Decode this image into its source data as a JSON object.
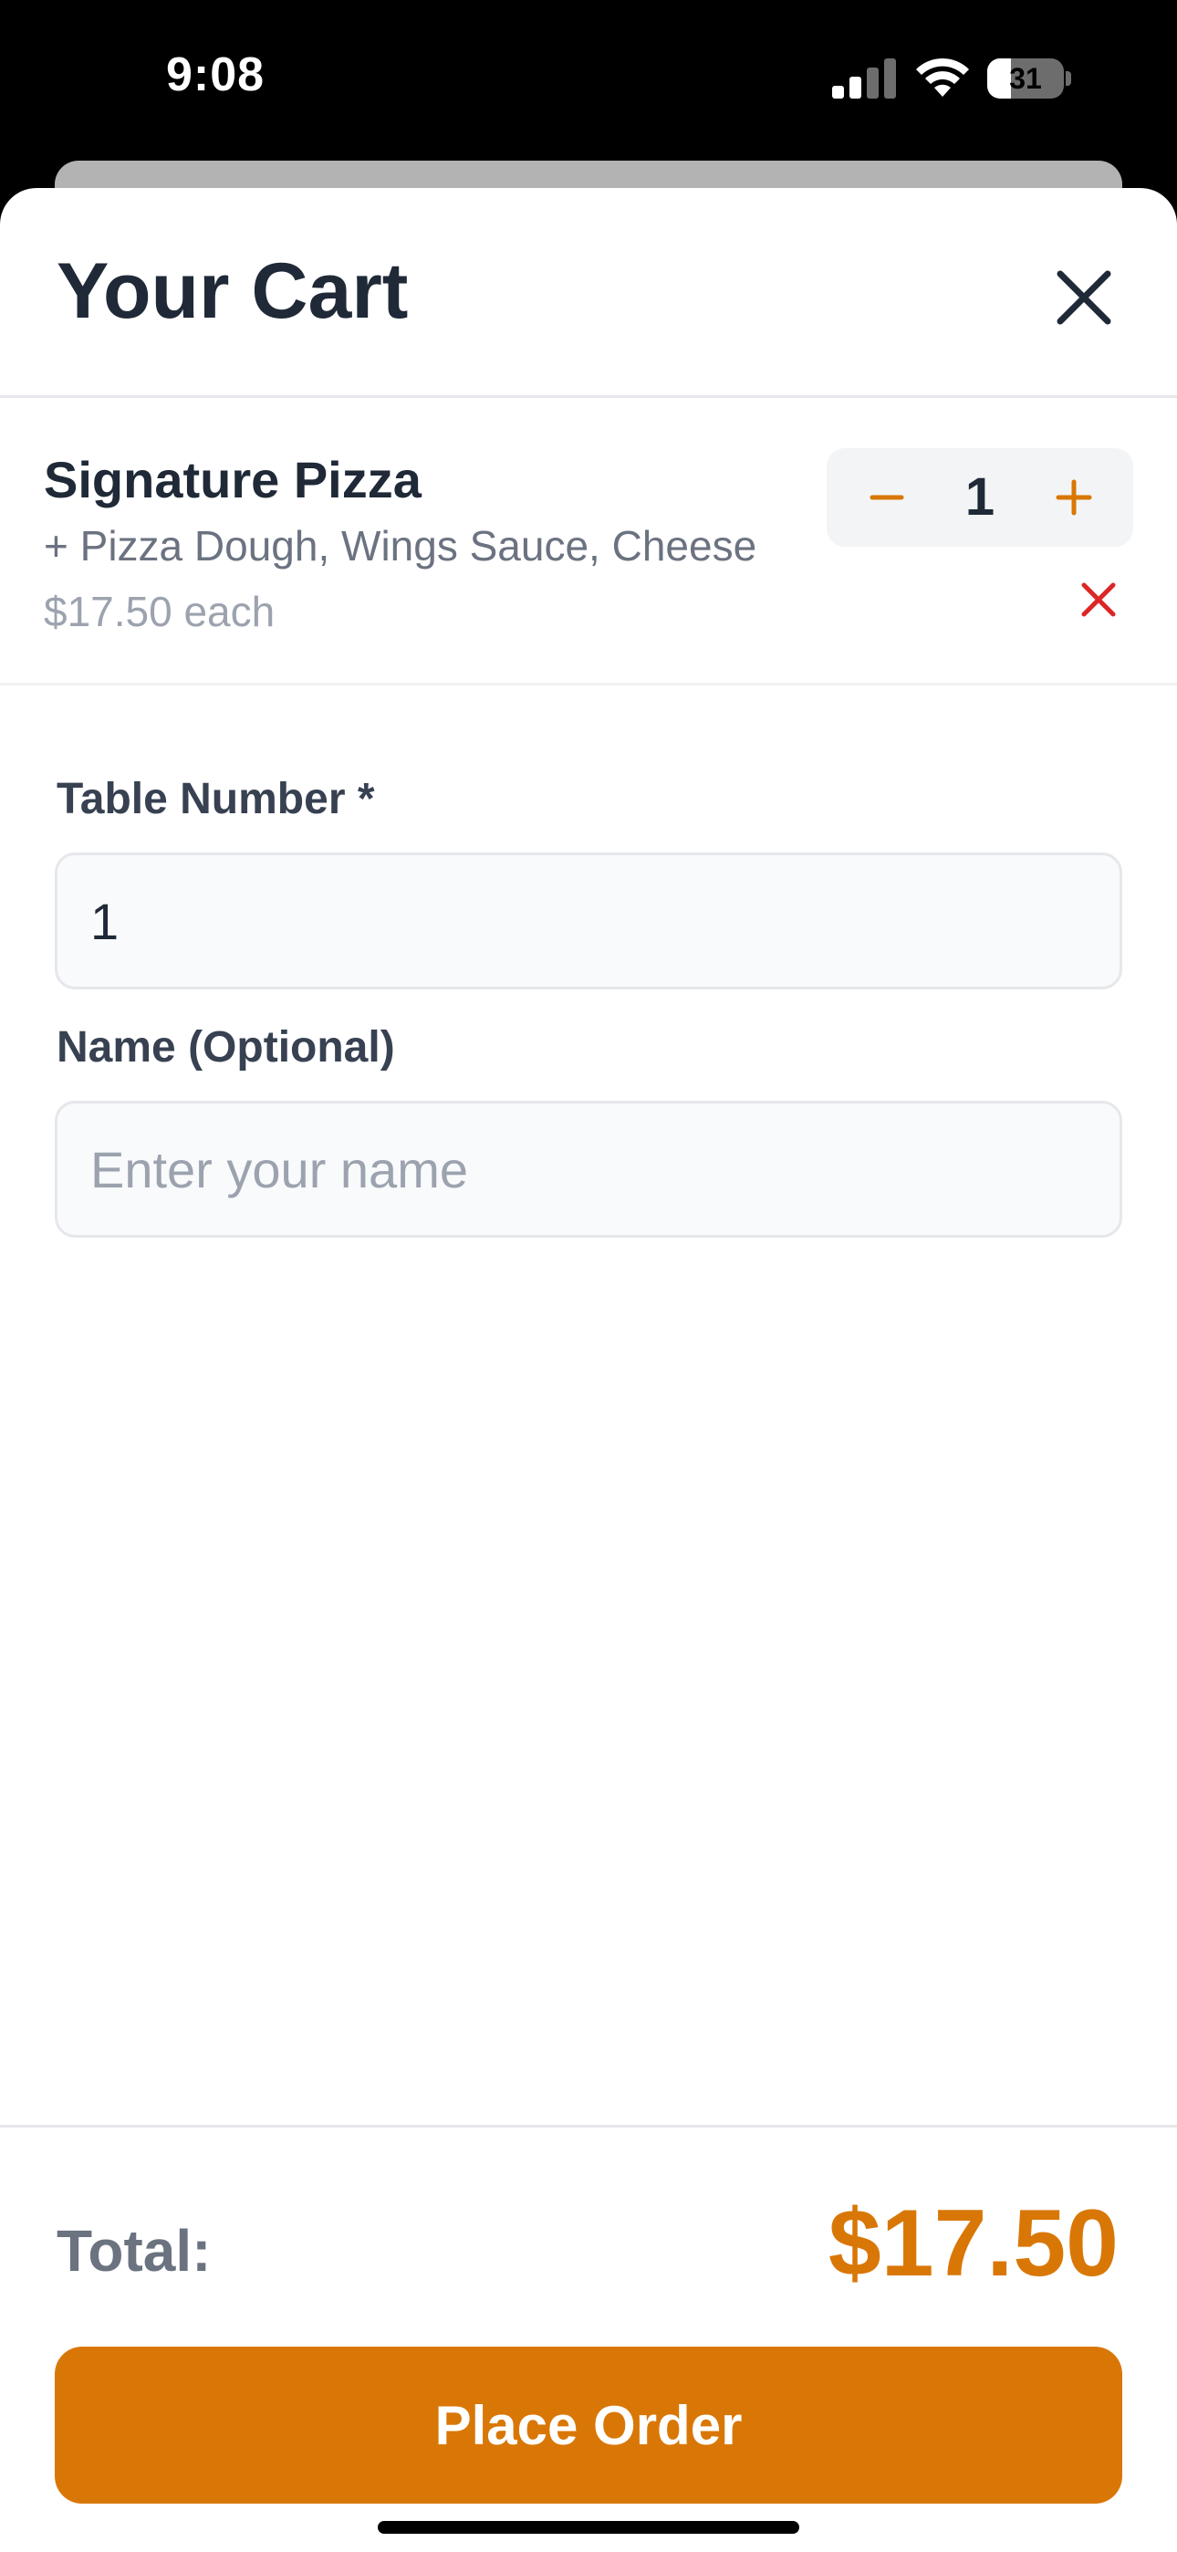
{
  "status_bar": {
    "time": "9:08",
    "battery_level": "31",
    "battery_fraction": 0.31,
    "icons": [
      "signal-icon",
      "wifi-icon",
      "battery-icon"
    ]
  },
  "cart": {
    "title": "Your Cart",
    "close_icon": "close-icon",
    "items": [
      {
        "name": "Signature Pizza",
        "options": "+ Pizza Dough, Wings Sauce, Cheese",
        "price_each": "$17.50 each",
        "quantity": "1",
        "decrement_icon": "minus-icon",
        "increment_icon": "plus-icon",
        "remove_icon": "remove-x-icon"
      }
    ]
  },
  "form": {
    "table_number": {
      "label": "Table Number *",
      "value": "1"
    },
    "name": {
      "label": "Name (Optional)",
      "value": "",
      "placeholder": "Enter your name"
    }
  },
  "footer": {
    "total_label": "Total:",
    "total_value": "$17.50",
    "place_order_label": "Place Order"
  },
  "colors": {
    "accent": "#d97706",
    "text_dark": "#1f2937",
    "text_muted": "#6b7280",
    "remove_red": "#dc2626"
  }
}
